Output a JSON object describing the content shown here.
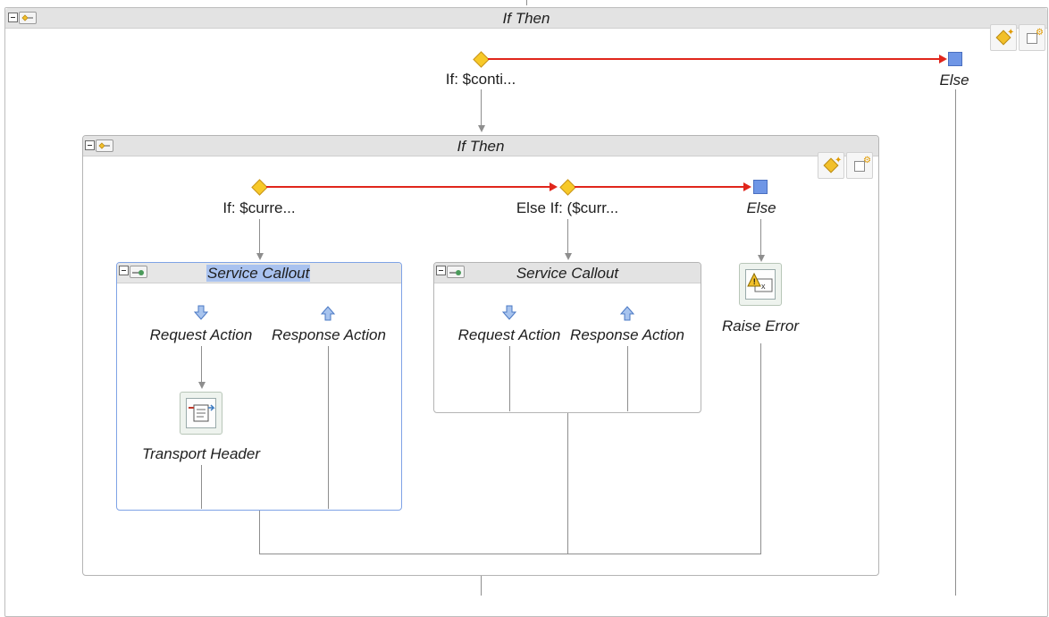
{
  "outer": {
    "title": "If Then",
    "if_label": "If: $conti...",
    "else_label": "Else"
  },
  "inner": {
    "title": "If Then",
    "if_label": "If: $curre...",
    "elseif_label": "Else If: ($curr...",
    "else_label": "Else"
  },
  "callout_left": {
    "title": "Service Callout",
    "request_label": "Request Action",
    "response_label": "Response Action",
    "transport_label": "Transport Header"
  },
  "callout_right": {
    "title": "Service Callout",
    "request_label": "Request Action",
    "response_label": "Response Action"
  },
  "raise_error": {
    "label": "Raise Error"
  },
  "colors": {
    "route_line": "#e0261c",
    "connector": "#8e8e8e",
    "header_bg": "#e3e3e3",
    "selected_header": "#a9c2ef",
    "selected_border": "#7fa3e6",
    "branch_diamond": "#f7c928",
    "else_square": "#6f96e6"
  },
  "icons": [
    "collapse-icon",
    "if-then-node-icon",
    "service-callout-node-icon",
    "add-condition-icon",
    "add-action-icon",
    "branch-diamond-icon",
    "else-square-icon",
    "request-arrow-icon",
    "response-arrow-icon",
    "transport-header-icon",
    "raise-error-icon"
  ]
}
